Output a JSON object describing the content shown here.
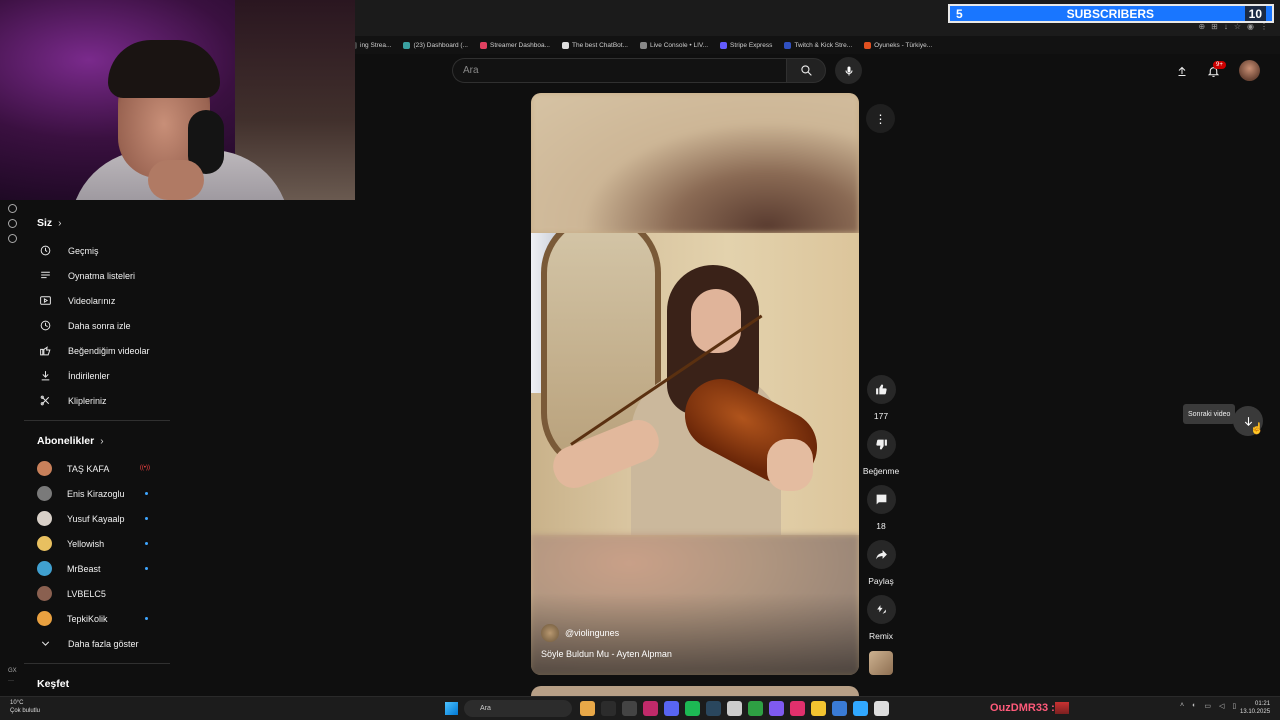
{
  "browser": {
    "bookmarks": [
      {
        "label": "ing Strea...",
        "color": "#444444"
      },
      {
        "label": "(23) Dashboard (...",
        "color": "#3aa0a0"
      },
      {
        "label": "Streamer Dashboa...",
        "color": "#e04060"
      },
      {
        "label": "The best ChatBot...",
        "color": "#dddddd"
      },
      {
        "label": "Live Console • LIV...",
        "color": "#888888"
      },
      {
        "label": "Stripe Express",
        "color": "#635bff"
      },
      {
        "label": "Twitch & Kick Stre...",
        "color": "#3050c0"
      },
      {
        "label": "Oyuneks - Türkiye...",
        "color": "#e05020"
      }
    ]
  },
  "overlay": {
    "sub_count": "5",
    "sub_label": "SUBSCRIBERS",
    "sub_target": "10",
    "bar_color": "#1976ff"
  },
  "header": {
    "search_placeholder": "Ara",
    "notification_badge": "9+"
  },
  "sidebar": {
    "you_title": "Siz",
    "you_items": [
      {
        "label": "Geçmiş",
        "icon": "history-icon"
      },
      {
        "label": "Oynatma listeleri",
        "icon": "playlist-icon"
      },
      {
        "label": "Videolarınız",
        "icon": "your-videos-icon"
      },
      {
        "label": "Daha sonra izle",
        "icon": "watch-later-icon"
      },
      {
        "label": "Beğendiğim videolar",
        "icon": "liked-icon"
      },
      {
        "label": "İndirilenler",
        "icon": "download-icon"
      },
      {
        "label": "Klipleriniz",
        "icon": "clips-icon"
      }
    ],
    "subs_title": "Abonelikler",
    "subscriptions": [
      {
        "label": "TAŞ KAFA",
        "color": "#c8805a",
        "status": "live"
      },
      {
        "label": "Enis Kirazoglu",
        "color": "#7a7a7a",
        "status": "dot"
      },
      {
        "label": "Yusuf Kayaalp",
        "color": "#d8d0c8",
        "status": "dot"
      },
      {
        "label": "Yellowish",
        "color": "#e8c060",
        "status": "dot"
      },
      {
        "label": "MrBeast",
        "color": "#40a0d0",
        "status": "dot"
      },
      {
        "label": "LVBELC5",
        "color": "#8a6050",
        "status": "none"
      },
      {
        "label": "TepkiKolik",
        "color": "#e8a040",
        "status": "dot"
      }
    ],
    "show_more": "Daha fazla göster",
    "explore_title": "Keşfet"
  },
  "short": {
    "channel": "@violingunes",
    "title": "Söyle Buldun Mu - Ayten Alpman",
    "likes": "177",
    "dislike_label": "Beğenme",
    "comments": "18",
    "share_label": "Paylaş",
    "remix_label": "Remix"
  },
  "next": {
    "tooltip": "Sonraki video"
  },
  "taskbar": {
    "weather_temp": "10°C",
    "weather_desc": "Çok bulutlu",
    "search_label": "Ara",
    "chat_user": "OuzDMR33 :",
    "time": "01:21",
    "date": "13.10.2025",
    "apps": [
      "#e8a848",
      "#2c2c2c",
      "#444444",
      "#c02a6a",
      "#5865f2",
      "#1db954",
      "#2a475e",
      "#cccccc",
      "#2ea043",
      "#7f5af0",
      "#e1306c",
      "#f4c430",
      "#3a7bd5",
      "#31a8ff",
      "#dddddd"
    ]
  }
}
